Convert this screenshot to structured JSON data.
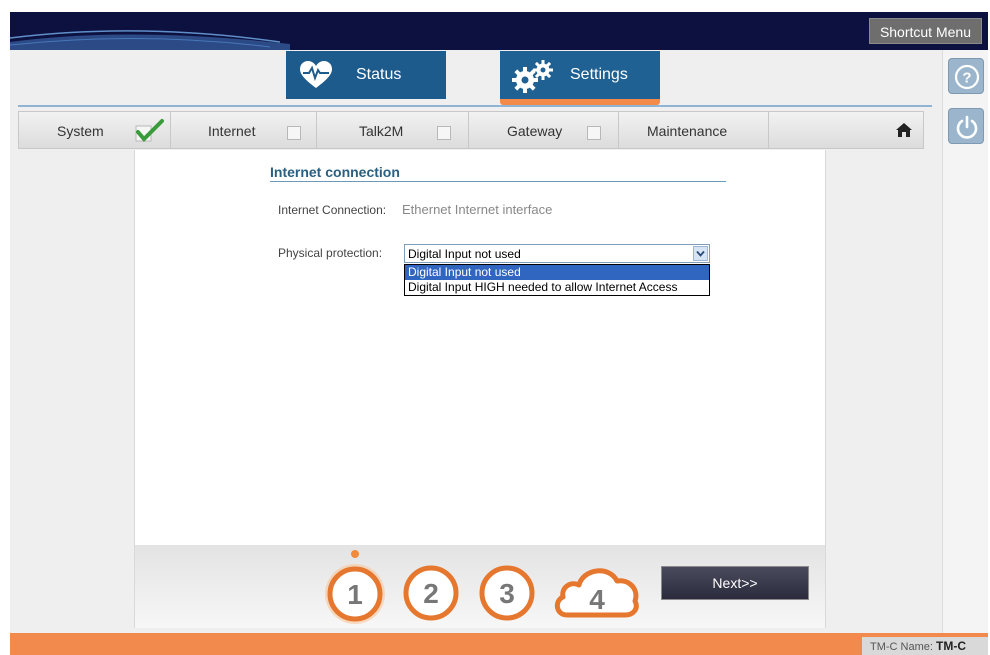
{
  "header": {
    "shortcut_menu": "Shortcut Menu"
  },
  "tabs": [
    {
      "label": "Status",
      "icon": "heart-pulse-icon"
    },
    {
      "label": "Settings",
      "icon": "gears-icon",
      "active": true
    }
  ],
  "subnav": {
    "items": [
      {
        "label": "System",
        "checked": true
      },
      {
        "label": "Internet",
        "checked": false
      },
      {
        "label": "Talk2M",
        "checked": false
      },
      {
        "label": "Gateway",
        "checked": false
      },
      {
        "label": "Maintenance"
      }
    ],
    "home_icon": "home-icon"
  },
  "section": {
    "title": "Internet connection",
    "conn_label": "Internet Connection:",
    "conn_value": "Ethernet Internet interface",
    "protection_label": "Physical protection:",
    "protection_selected": "Digital Input not used",
    "options": [
      "Digital Input not used",
      "Digital Input HIGH needed to allow Internet Access"
    ]
  },
  "wizard": {
    "steps": [
      "1",
      "2",
      "3",
      "4"
    ],
    "current_step": 1,
    "next_label": "Next>>"
  },
  "side_buttons": {
    "help_icon": "help-icon",
    "power_icon": "power-icon"
  },
  "footer": {
    "name_label": "TM-C Name:",
    "name_value": "TM-C"
  },
  "colors": {
    "navy": "#0d1140",
    "tab_blue": "#1d5b8c",
    "orange": "#f28a4d",
    "select_blue": "#3166c0"
  }
}
